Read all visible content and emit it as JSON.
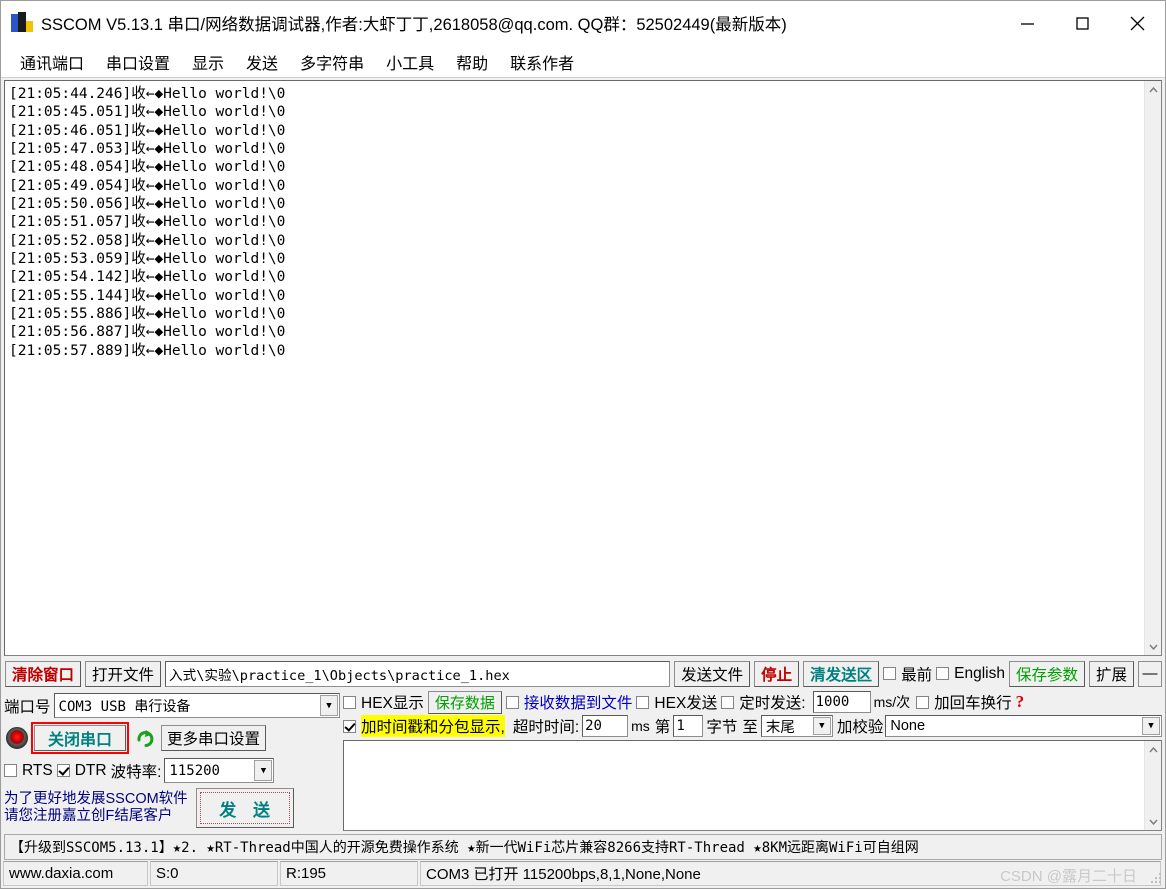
{
  "window": {
    "title": "SSCOM V5.13.1 串口/网络数据调试器,作者:大虾丁丁,2618058@qq.com. QQ群：52502449(最新版本)",
    "icon": "app-icon",
    "minimize": "−",
    "maximize": "□",
    "close": "✕"
  },
  "menu": {
    "items": [
      {
        "label": "通讯端口"
      },
      {
        "label": "串口设置"
      },
      {
        "label": "显示"
      },
      {
        "label": "发送"
      },
      {
        "label": "多字符串"
      },
      {
        "label": "小工具"
      },
      {
        "label": "帮助"
      },
      {
        "label": "联系作者"
      }
    ]
  },
  "receive": {
    "lines": [
      "[21:05:44.246]收←◆Hello world!\\0",
      "[21:05:45.051]收←◆Hello world!\\0",
      "[21:05:46.051]收←◆Hello world!\\0",
      "[21:05:47.053]收←◆Hello world!\\0",
      "[21:05:48.054]收←◆Hello world!\\0",
      "[21:05:49.054]收←◆Hello world!\\0",
      "[21:05:50.056]收←◆Hello world!\\0",
      "[21:05:51.057]收←◆Hello world!\\0",
      "[21:05:52.058]收←◆Hello world!\\0",
      "[21:05:53.059]收←◆Hello world!\\0",
      "[21:05:54.142]收←◆Hello world!\\0",
      "[21:05:55.144]收←◆Hello world!\\0",
      "[21:05:55.886]收←◆Hello world!\\0",
      "[21:05:56.887]收←◆Hello world!\\0",
      "[21:05:57.889]收←◆Hello world!\\0"
    ],
    "text": "[21:05:44.246]收←◆Hello world!\\0\n[21:05:45.051]收←◆Hello world!\\0\n[21:05:46.051]收←◆Hello world!\\0\n[21:05:47.053]收←◆Hello world!\\0\n[21:05:48.054]收←◆Hello world!\\0\n[21:05:49.054]收←◆Hello world!\\0\n[21:05:50.056]收←◆Hello world!\\0\n[21:05:51.057]收←◆Hello world!\\0\n[21:05:52.058]收←◆Hello world!\\0\n[21:05:53.059]收←◆Hello world!\\0\n[21:05:54.142]收←◆Hello world!\\0\n[21:05:55.144]收←◆Hello world!\\0\n[21:05:55.886]收←◆Hello world!\\0\n[21:05:56.887]收←◆Hello world!\\0\n[21:05:57.889]收←◆Hello world!\\0",
    "scroll_up": "⌃",
    "scroll_down": "⌄"
  },
  "toolbar": {
    "clear_window": "清除窗口",
    "open_file": "打开文件",
    "file_path": "入式\\实验\\practice_1\\Objects\\practice_1.hex",
    "send_file": "发送文件",
    "stop": "停止",
    "clear_send": "清发送区",
    "topmost": "最前",
    "topmost_checked": false,
    "english": "English",
    "english_checked": false,
    "save_params": "保存参数",
    "extend": "扩展",
    "collapse": "—"
  },
  "port_panel": {
    "port_label": "端口号",
    "port_value": "COM3 USB 串行设备",
    "close_port_button": "关闭串口",
    "refresh_icon": "↻",
    "more_settings": "更多串口设置",
    "rts_label": "RTS",
    "rts_checked": false,
    "dtr_label": "DTR",
    "dtr_checked": true,
    "baud_label": "波特率:",
    "baud_value": "115200",
    "promo_line1": "为了更好地发展SSCOM软件",
    "promo_line2": "请您注册嘉立创F结尾客户",
    "send_button": "发 送"
  },
  "options": {
    "hex_display": "HEX显示",
    "hex_display_checked": false,
    "save_data": "保存数据",
    "recv_to_file": "接收数据到文件",
    "recv_to_file_checked": false,
    "hex_send": "HEX发送",
    "hex_send_checked": false,
    "timed_send": "定时发送:",
    "timed_send_checked": false,
    "timed_interval": "1000",
    "interval_unit": "ms/次",
    "crlf": "加回车换行",
    "crlf_checked": false,
    "timestamp_label": "加时间戳和分包显示,",
    "timestamp_checked": true,
    "timeout_label": "超时时间:",
    "timeout_value": "20",
    "timeout_unit": "ms",
    "byte_from_label": "第",
    "byte_from_value": "1",
    "byte_label": "字节",
    "to_label": "至",
    "byte_to_value": "末尾",
    "checksum_label": "加校验",
    "checksum_value": "None",
    "help_mark": "?"
  },
  "send_area": {
    "value": "",
    "scroll_up": "⌃",
    "scroll_down": "⌄"
  },
  "adbar": {
    "text": "【升级到SSCOM5.13.1】★2.  ★RT-Thread中国人的开源免费操作系统 ★新一代WiFi芯片兼容8266支持RT-Thread ★8KM远距离WiFi可自组网"
  },
  "statusbar": {
    "website": "www.daxia.com",
    "sent": "S:0",
    "received": "R:195",
    "connection": "COM3 已打开  115200bps,8,1,None,None",
    "watermark": "CSDN @露月二十日"
  },
  "colors": {
    "red": "#c00000",
    "teal": "#008080",
    "green": "#00a000",
    "blue": "#0000c0",
    "highlight_yellow": "#ffff00",
    "red_outline": "#ff0000"
  }
}
